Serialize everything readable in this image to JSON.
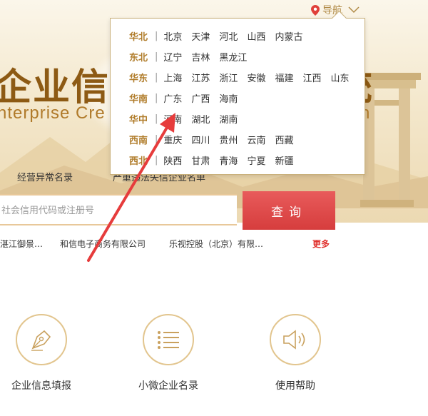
{
  "header": {
    "nav_label": "导航",
    "nav_icons": [
      "location-pin-icon",
      "chevron-down-icon"
    ]
  },
  "hero": {
    "title_cn_left": "企业信",
    "title_cn_right": "统",
    "title_en_left": "nterprise Cre",
    "title_en_right": "n"
  },
  "region_dropdown": {
    "regions": [
      {
        "name": "华北",
        "provinces": [
          "北京",
          "天津",
          "河北",
          "山西",
          "内蒙古"
        ]
      },
      {
        "name": "东北",
        "provinces": [
          "辽宁",
          "吉林",
          "黑龙江"
        ]
      },
      {
        "name": "华东",
        "provinces": [
          "上海",
          "江苏",
          "浙江",
          "安徽",
          "福建",
          "江西",
          "山东"
        ]
      },
      {
        "name": "华南",
        "provinces": [
          "广东",
          "广西",
          "海南"
        ]
      },
      {
        "name": "华中",
        "provinces": [
          "河南",
          "湖北",
          "湖南"
        ]
      },
      {
        "name": "西南",
        "provinces": [
          "重庆",
          "四川",
          "贵州",
          "云南",
          "西藏"
        ]
      },
      {
        "name": "西北",
        "provinces": [
          "陕西",
          "甘肃",
          "青海",
          "宁夏",
          "新疆"
        ]
      }
    ],
    "separator": "|"
  },
  "tabs": {
    "abnormal_list": "经营异常名录",
    "serious_list": "严重违法失信企业名单"
  },
  "search": {
    "placeholder": "社会信用代码或注册号",
    "button_label": "查询"
  },
  "recent_companies": [
    "湛江御景…",
    "和信电子商务有限公司",
    "乐视控股（北京）有限…"
  ],
  "more_label": "更多",
  "features": [
    {
      "label": "企业信息填报",
      "icon": "pen-nib-icon"
    },
    {
      "label": "小微企业名录",
      "icon": "list-icon"
    },
    {
      "label": "使用帮助",
      "icon": "speaker-icon"
    }
  ],
  "colors": {
    "accent_gold": "#b07c2a",
    "search_red": "#e04545",
    "more_red": "#e0312d",
    "annotation_arrow": "#e63c3c"
  }
}
